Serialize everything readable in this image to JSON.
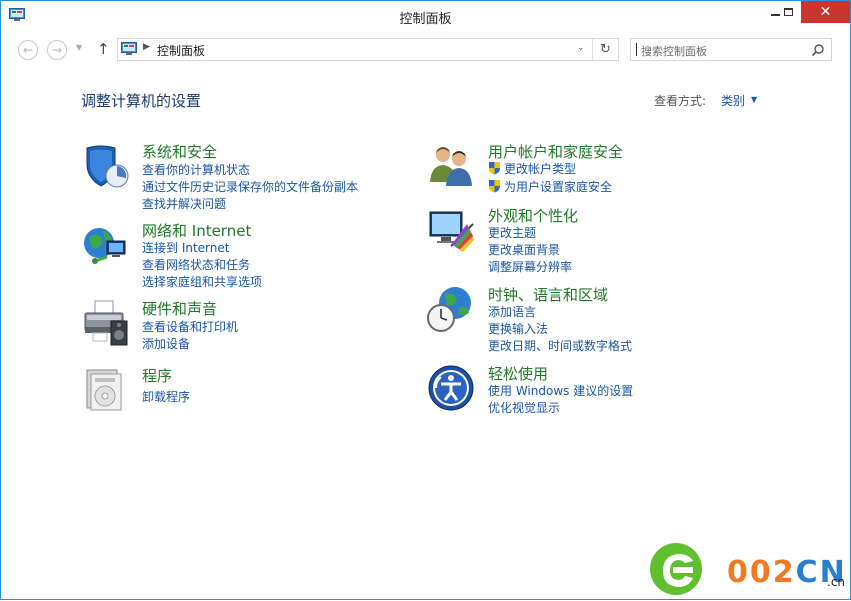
{
  "window": {
    "title": "控制面板"
  },
  "address": {
    "crumb": "控制面板"
  },
  "search": {
    "placeholder": "搜索控制面板"
  },
  "content": {
    "heading": "调整计算机的设置",
    "view_by_label": "查看方式:",
    "view_by_value": "类别"
  },
  "left_categories": [
    {
      "title": "系统和安全",
      "icon": "shield-icon",
      "links": [
        "查看你的计算机状态",
        "通过文件历史记录保存你的文件备份副本",
        "查找并解决问题"
      ]
    },
    {
      "title": "网络和 Internet",
      "icon": "network-globe-icon",
      "links": [
        "连接到 Internet",
        "查看网络状态和任务",
        "选择家庭组和共享选项"
      ]
    },
    {
      "title": "硬件和声音",
      "icon": "printer-icon",
      "links": [
        "查看设备和打印机",
        "添加设备"
      ]
    },
    {
      "title": "程序",
      "icon": "programs-icon",
      "links": [
        "卸载程序"
      ]
    }
  ],
  "right_categories": [
    {
      "title": "用户帐户和家庭安全",
      "icon": "users-icon",
      "links": [
        "更改帐户类型",
        "为用户设置家庭安全"
      ]
    },
    {
      "title": "外观和个性化",
      "icon": "appearance-icon",
      "links": [
        "更改主题",
        "更改桌面背景",
        "调整屏幕分辨率"
      ]
    },
    {
      "title": "时钟、语言和区域",
      "icon": "clock-globe-icon",
      "links": [
        "添加语言",
        "更换输入法",
        "更改日期、时间或数字格式"
      ]
    },
    {
      "title": "轻松使用",
      "icon": "ease-of-access-icon",
      "links": [
        "使用 Windows 建议的设置",
        "优化视觉显示"
      ]
    }
  ],
  "watermark": {
    "text_a": "002",
    "text_b": "CN",
    "suffix": ".cn"
  }
}
